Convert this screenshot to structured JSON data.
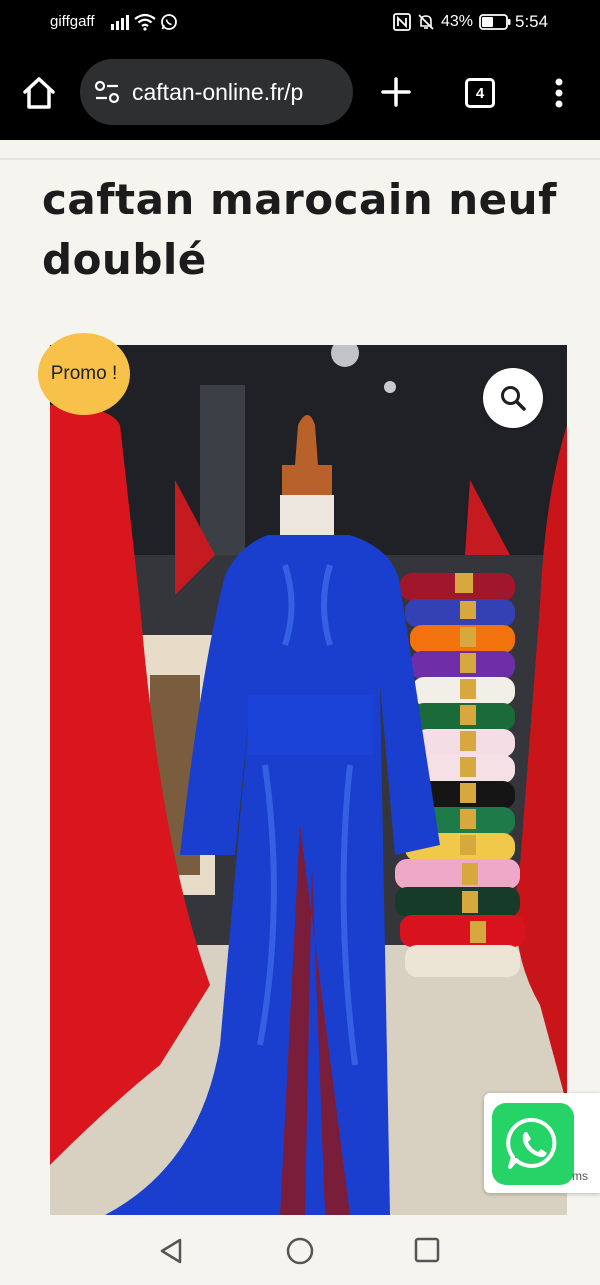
{
  "status_bar": {
    "carrier": "giffgaff",
    "battery_percent": "43%",
    "time": "5:54",
    "icons": [
      "signal-icon",
      "wifi-icon",
      "whatsapp-notification-icon",
      "nfc-icon",
      "mute-icon",
      "battery-icon"
    ]
  },
  "browser": {
    "url": "caftan-online.fr/p",
    "tab_count": "4",
    "icons": [
      "home-icon",
      "site-settings-icon",
      "plus-icon",
      "tabs-icon",
      "more-vert-icon"
    ]
  },
  "product": {
    "title": "caftan marocain neuf doublé",
    "promo_label": "Promo !",
    "image_alt": "caftan-image",
    "zoom_icon": "search-icon"
  },
  "whatsapp": {
    "icon": "whatsapp-icon",
    "cut_text": "ms"
  },
  "nav_bar": {
    "icons": [
      "back-icon",
      "home-circle-icon",
      "recents-icon"
    ]
  },
  "colors": {
    "page_bg": "#f6f4ef",
    "bar_bg": "#000000",
    "url_pill": "#2d2f31",
    "promo": "#f7c14a",
    "whatsapp": "#25d366",
    "caftan_blue": "#1a3fcf"
  }
}
